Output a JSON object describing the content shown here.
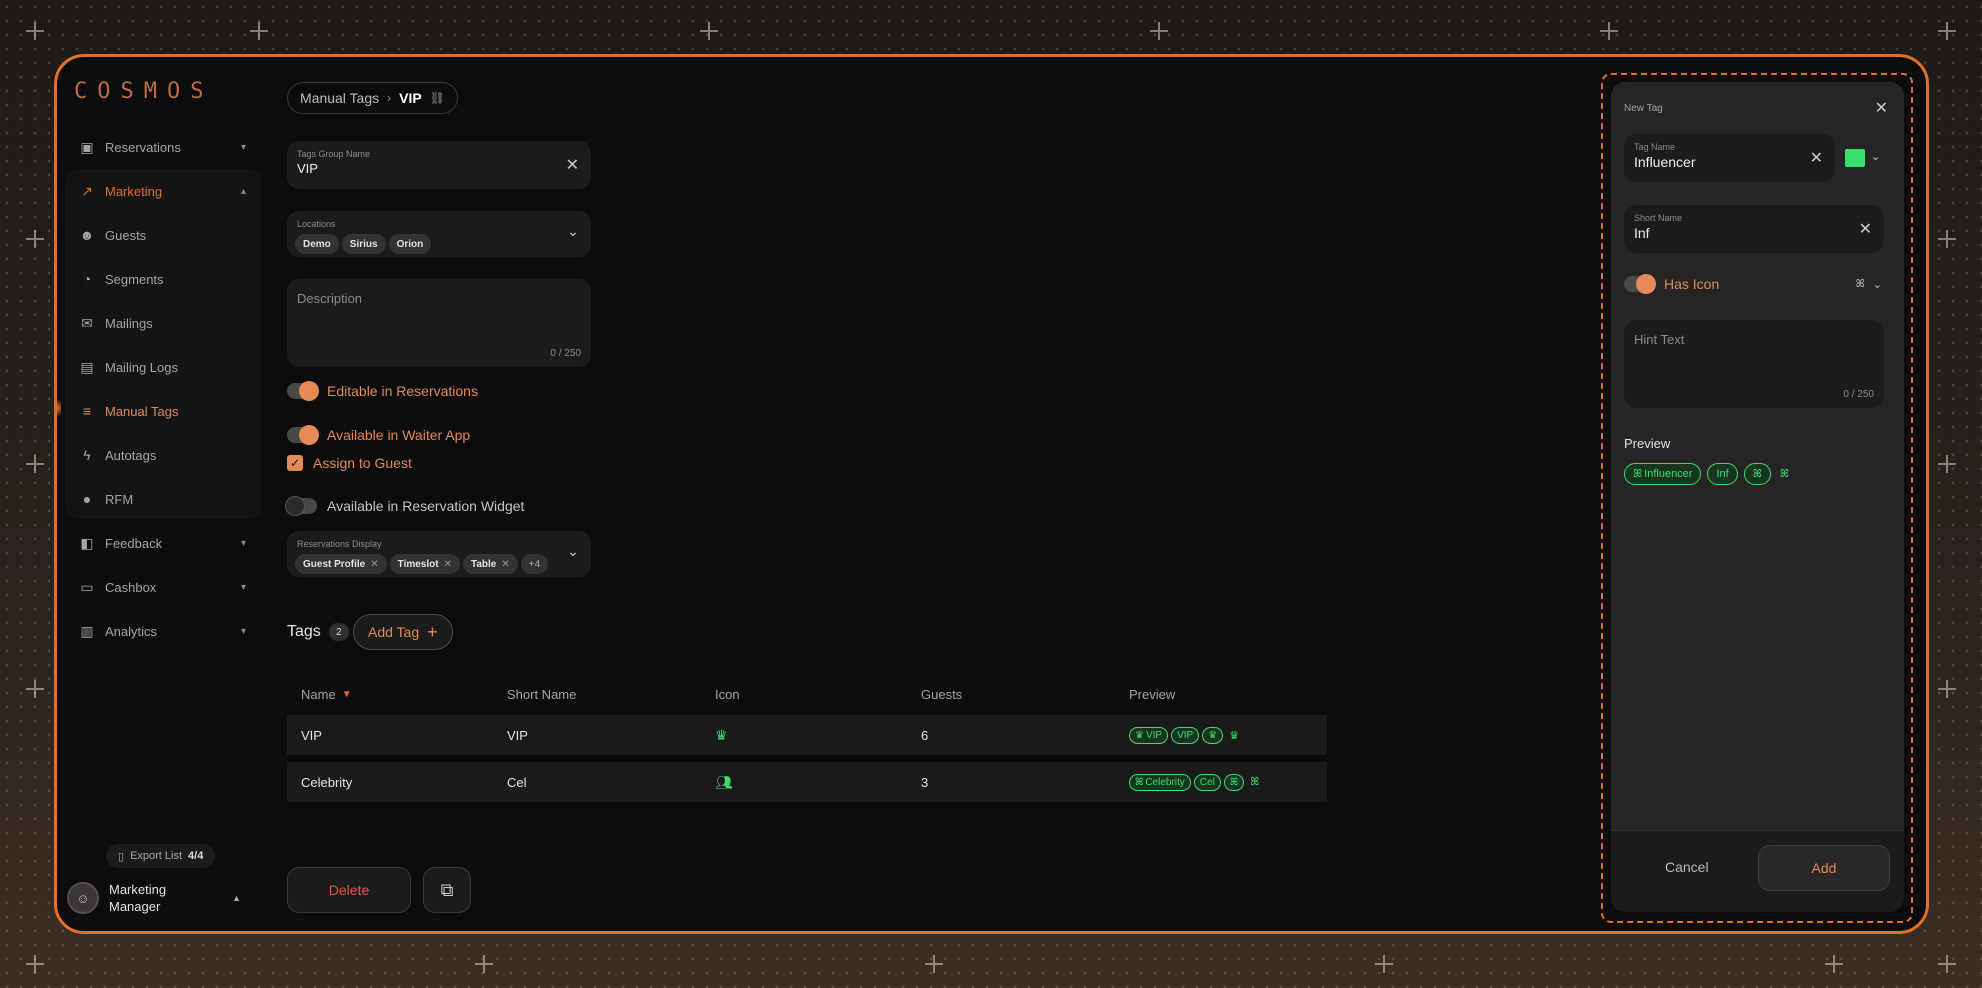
{
  "brand": {
    "logo": "COSMOS"
  },
  "sidebar": {
    "items": [
      {
        "label": "Reservations",
        "icon": "calendar-icon"
      },
      {
        "label": "Marketing",
        "icon": "trend-icon"
      },
      {
        "label": "Guests",
        "icon": "smile-icon"
      },
      {
        "label": "Segments",
        "icon": "pie-icon"
      },
      {
        "label": "Mailings",
        "icon": "mail-icon"
      },
      {
        "label": "Mailing Logs",
        "icon": "chat-icon"
      },
      {
        "label": "Manual Tags",
        "icon": "tags-icon"
      },
      {
        "label": "Autotags",
        "icon": "bolt-icon"
      },
      {
        "label": "RFM",
        "icon": "pin-icon"
      },
      {
        "label": "Feedback",
        "icon": "feedback-icon"
      },
      {
        "label": "Cashbox",
        "icon": "cashbox-icon"
      },
      {
        "label": "Analytics",
        "icon": "analytics-icon"
      }
    ],
    "export_label": "Export List",
    "export_count": "4/4",
    "user_name_line1": "Marketing",
    "user_name_line2": "Manager"
  },
  "breadcrumb": {
    "parent": "Manual Tags",
    "current": "VIP"
  },
  "form": {
    "group_name_label": "Tags Group Name",
    "group_name_value": "VIP",
    "locations_label": "Locations",
    "locations": [
      "Demo",
      "Sirius",
      "Orion"
    ],
    "description_placeholder": "Description",
    "description_counter": "0 / 250",
    "toggles": {
      "editable": "Editable in Reservations",
      "waiter": "Available in Waiter App",
      "assign": "Assign to Guest",
      "widget": "Available in Reservation Widget"
    },
    "display_label": "Reservations Display",
    "display_chips": [
      "Guest Profile",
      "Timeslot",
      "Table"
    ],
    "display_more": "+4"
  },
  "tags": {
    "title": "Tags",
    "count": "2",
    "add_label": "Add Tag",
    "columns": [
      "Name",
      "Short Name",
      "Icon",
      "Guests",
      "Preview"
    ],
    "rows": [
      {
        "name": "VIP",
        "short": "VIP",
        "icon": "crown-icon",
        "guests": "6",
        "preview_name": "VIP",
        "preview_short": "VIP"
      },
      {
        "name": "Celebrity",
        "short": "Cel",
        "icon": "group-icon",
        "guests": "3",
        "preview_name": "Celebrity",
        "preview_short": "Cel"
      }
    ]
  },
  "actions": {
    "delete_label": "Delete"
  },
  "panel": {
    "title": "New Tag",
    "tag_name_label": "Tag Name",
    "tag_name_value": "Influencer",
    "short_name_label": "Short Name",
    "short_name_value": "Inf",
    "has_icon_label": "Has Icon",
    "hint_placeholder": "Hint Text",
    "hint_counter": "0 / 250",
    "preview_label": "Preview",
    "preview_name": "Influencer",
    "preview_short": "Inf",
    "tag_color": "#3ddc6f",
    "cancel_label": "Cancel",
    "add_label": "Add"
  },
  "colors": {
    "accent": "#e2702a",
    "tag_green": "#3ddc6f",
    "danger": "#f0504d"
  }
}
